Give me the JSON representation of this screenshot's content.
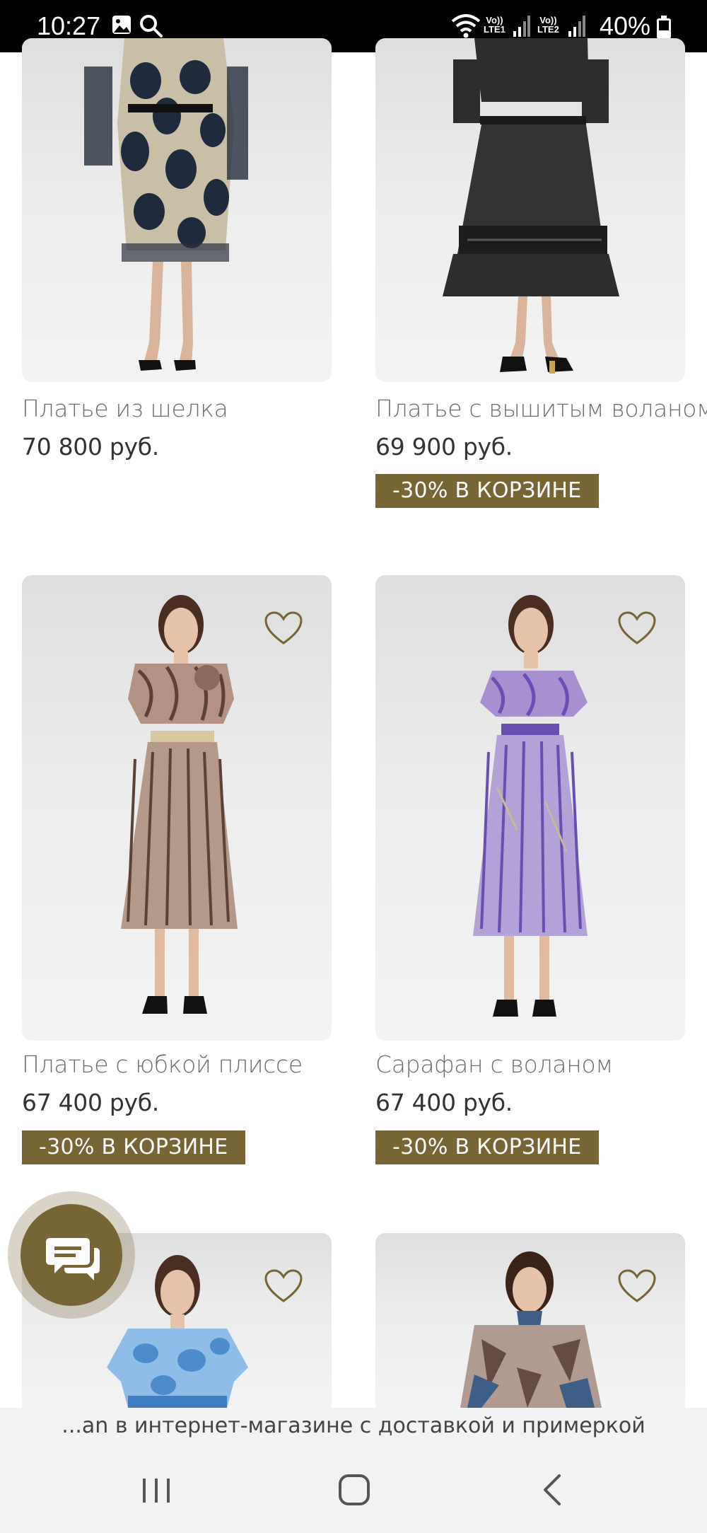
{
  "status_bar": {
    "time": "10:27",
    "battery": "40%",
    "sim1_top": "Vo))",
    "sim1_bottom": "LTE1",
    "sim2_top": "Vo))",
    "sim2_bottom": "LTE2",
    "icons": [
      "image-icon",
      "search-icon",
      "wifi-icon",
      "signal-icon",
      "battery-icon"
    ]
  },
  "products": [
    {
      "name": "Платье из шелка",
      "price": "70 800 руб.",
      "badge": "",
      "dress_color": "#1f2a3c",
      "accent": "#c9b99a"
    },
    {
      "name": "Платье с вышитым воланом",
      "price": "69 900 руб.",
      "badge": "-30% В КОРЗИНЕ",
      "dress_color": "#2d2d2d",
      "accent": "#444444"
    },
    {
      "name": "Платье с юбкой плиссе",
      "price": "67 400 руб.",
      "badge": "-30% В КОРЗИНЕ",
      "dress_color": "#9d7d6c",
      "accent": "#5a4236"
    },
    {
      "name": "Сарафан с воланом",
      "price": "67 400 руб.",
      "badge": "-30% В КОРЗИНЕ",
      "dress_color": "#9a82c8",
      "accent": "#6a4fb3"
    },
    {
      "name": "",
      "price": "",
      "badge": "",
      "dress_color": "#7fb0e0",
      "accent": "#3e7fc4"
    },
    {
      "name": "",
      "price": "",
      "badge": "",
      "dress_color": "#a48a7d",
      "accent": "#3d5f85"
    }
  ],
  "url_text": "...an в интернет-магазине с доставкой и примеркой",
  "colors": {
    "accent": "#786535",
    "status_bar": "#000000"
  }
}
